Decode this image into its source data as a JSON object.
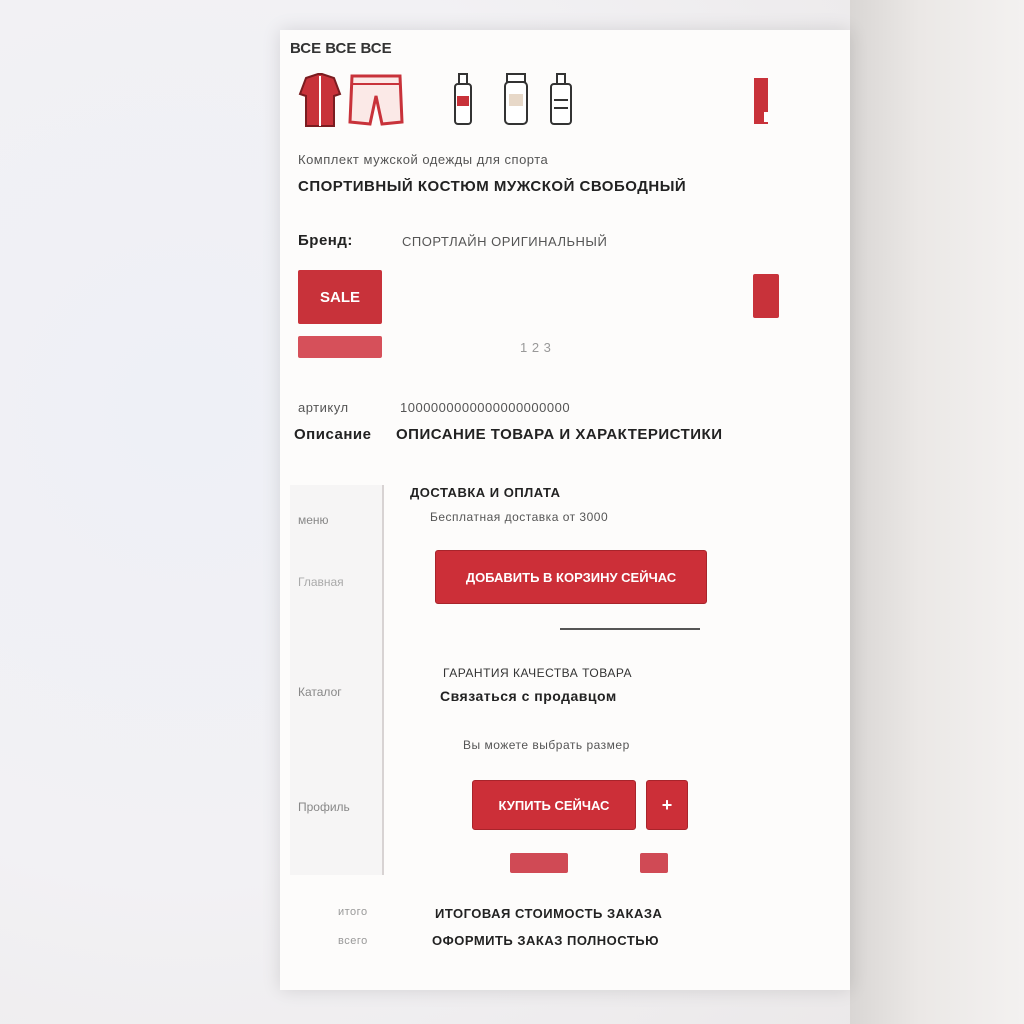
{
  "header": {
    "tabs_text": "ВСЕ ВСЕ ВСЕ"
  },
  "icons": {
    "items": [
      "jacket-icon",
      "shorts-icon",
      "bottle-icon",
      "jar-icon",
      "spray-bottle-icon",
      "tag-icon"
    ]
  },
  "product": {
    "line1": "Комплект мужской одежды для спорта",
    "line2": "СПОРТИВНЫЙ КОСТЮМ МУЖСКОЙ СВОБОДНЫЙ",
    "brand_label": "Бренд:",
    "brand_value": "СПОРТЛАЙН ОРИГИНАЛЬНЫЙ",
    "sale_chip": "SALE",
    "price_small": "1 2 3"
  },
  "details": {
    "label_small": "артикул",
    "value_small": "1000000000000000000000",
    "label_bold": "Описание",
    "value_bold": "ОПИСАНИЕ ТОВАРА И ХАРАКТЕРИСТИКИ"
  },
  "sidebar": {
    "items": [
      "меню",
      "Главная",
      "Каталог",
      "Профиль"
    ]
  },
  "panel": {
    "heading": "ДОСТАВКА И ОПЛАТА",
    "subheading": "Бесплатная доставка от 3000",
    "primary_button": "ДОБАВИТЬ В КОРЗИНУ СЕЙЧАС",
    "info_line1": "ГАРАНТИЯ КАЧЕСТВА ТОВАРА",
    "info_line2": "Связаться с продавцом",
    "note": "Вы  можете выбрать размер",
    "buy_button": "КУПИТЬ СЕЙЧАС",
    "plus_button": "+"
  },
  "footer": {
    "small1": "итого",
    "small2": "всего",
    "line1": "ИТОГОВАЯ СТОИМОСТЬ ЗАКАЗА",
    "line2": "ОФОРМИТЬ ЗАКАЗ ПОЛНОСТЬЮ"
  },
  "colors": {
    "accent": "#c8323a",
    "page": "#fdfcfb"
  }
}
